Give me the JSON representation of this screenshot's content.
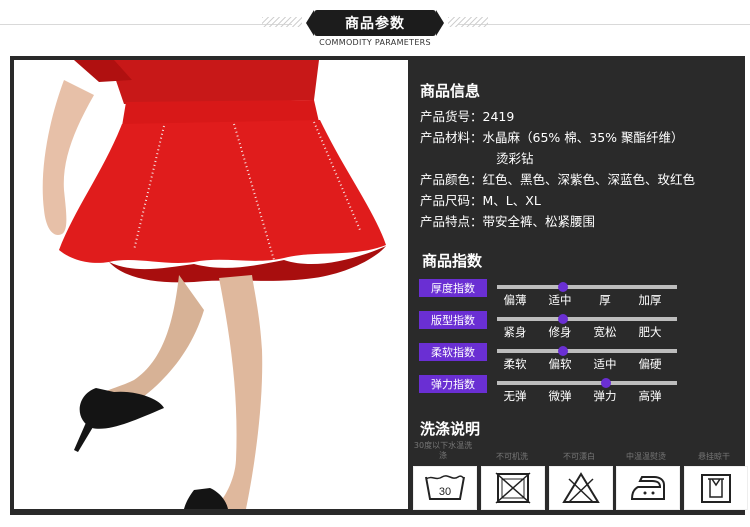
{
  "header": {
    "title": "商品参数",
    "subtitle": "COMMODITY PARAMETERS"
  },
  "info": {
    "section_title": "商品信息",
    "rows": [
      {
        "label": "产品货号：",
        "value": "2419"
      },
      {
        "label": "产品材料：",
        "value": "水晶麻（65% 棉、35% 聚酯纤维）"
      },
      {
        "label": "",
        "value": "烫彩钻"
      },
      {
        "label": "产品颜色：",
        "value": "红色、黑色、深紫色、深蓝色、玫红色"
      },
      {
        "label": "产品尺码：",
        "value": "M、L、XL"
      },
      {
        "label": "产品特点：",
        "value": "带安全裤、松紧腰围"
      }
    ]
  },
  "indices": {
    "section_title": "商品指数",
    "accent_color": "#6a2fd3",
    "items": [
      {
        "label": "厚度指数",
        "levels": [
          "偏薄",
          "适中",
          "厚",
          "加厚"
        ],
        "selected": 2
      },
      {
        "label": "版型指数",
        "levels": [
          "紧身",
          "修身",
          "宽松",
          "肥大"
        ],
        "selected": 2
      },
      {
        "label": "柔软指数",
        "levels": [
          "柔软",
          "偏软",
          "适中",
          "偏硬"
        ],
        "selected": 2
      },
      {
        "label": "弹力指数",
        "levels": [
          "无弹",
          "微弹",
          "弹力",
          "高弹"
        ],
        "selected": 3
      }
    ]
  },
  "wash": {
    "section_title": "洗涤说明",
    "items": [
      {
        "label": "30度以下水温洗涤",
        "icon": "wash-30-icon",
        "icon_text": "30"
      },
      {
        "label": "不可机洗",
        "icon": "no-machine-wash-icon"
      },
      {
        "label": "不可漂白",
        "icon": "no-bleach-icon"
      },
      {
        "label": "中温温熨烫",
        "icon": "iron-medium-icon"
      },
      {
        "label": "悬挂晾干",
        "icon": "hang-dry-icon"
      }
    ]
  }
}
